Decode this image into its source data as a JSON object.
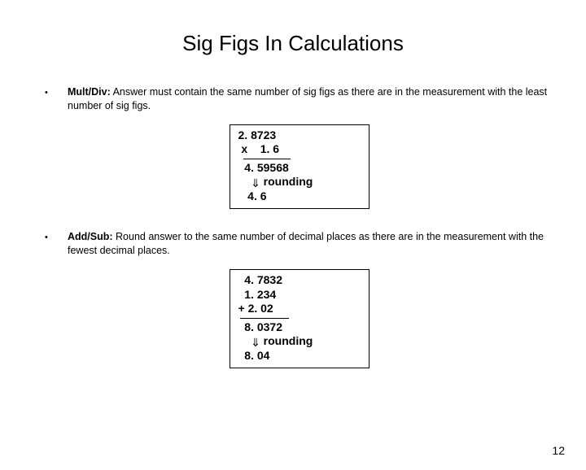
{
  "title": "Sig Figs In Calculations",
  "bullets": {
    "multDiv": {
      "label": "Mult/Div:",
      "text": "  Answer must contain the same number of sig figs as there are in the measurement with the least number of sig figs."
    },
    "addSub": {
      "label": "Add/Sub:",
      "text": "  Round answer to the same number of decimal places as there are in the measurement with the fewest decimal places."
    }
  },
  "box1": {
    "l1": "2. 8723",
    "l2": " x    1. 6",
    "l3": "  4. 59568",
    "arrowLabel": " rounding",
    "l5": "   4. 6"
  },
  "box2": {
    "l1": "  4. 7832",
    "l2": "  1. 234",
    "l3": "+ 2. 02",
    "l4": "  8. 0372",
    "arrowLabel": " rounding",
    "l6": "  8. 04"
  },
  "pageNumber": "12"
}
